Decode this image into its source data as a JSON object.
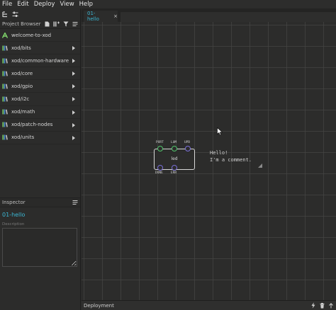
{
  "menubar": {
    "items": [
      "File",
      "Edit",
      "Deploy",
      "View",
      "Help"
    ]
  },
  "project_browser": {
    "title": "Project Browser",
    "libraries": [
      {
        "label": "welcome-to-xod",
        "icon": "xod-logo-icon"
      },
      {
        "label": "xod/bits",
        "icon": "library-icon"
      },
      {
        "label": "xod/common-hardware",
        "icon": "library-icon"
      },
      {
        "label": "xod/core",
        "icon": "library-icon"
      },
      {
        "label": "xod/gpio",
        "icon": "library-icon"
      },
      {
        "label": "xod/i2c",
        "icon": "library-icon"
      },
      {
        "label": "xod/math",
        "icon": "library-icon"
      },
      {
        "label": "xod/patch-nodes",
        "icon": "library-icon"
      },
      {
        "label": "xod/units",
        "icon": "library-icon"
      }
    ]
  },
  "inspector": {
    "title": "Inspector",
    "patch_name": "01-hello",
    "description_label": "Description",
    "description_value": ""
  },
  "tabs": [
    {
      "label": "01-hello",
      "close": "×"
    }
  ],
  "node": {
    "label": "led",
    "inputs": [
      "PORT",
      "LUM",
      "UPD"
    ],
    "outputs": [
      "DONE",
      "ERR"
    ]
  },
  "comment": {
    "text": "Hello!\nI'm a comment."
  },
  "deployment": {
    "title": "Deployment"
  },
  "colors": {
    "accent": "#3bb7d4",
    "pin_green": "#4fc36a",
    "pin_purple": "#7a6fd8",
    "lib_green": "#7ed36a",
    "lib_blue": "#4d8fd8"
  }
}
